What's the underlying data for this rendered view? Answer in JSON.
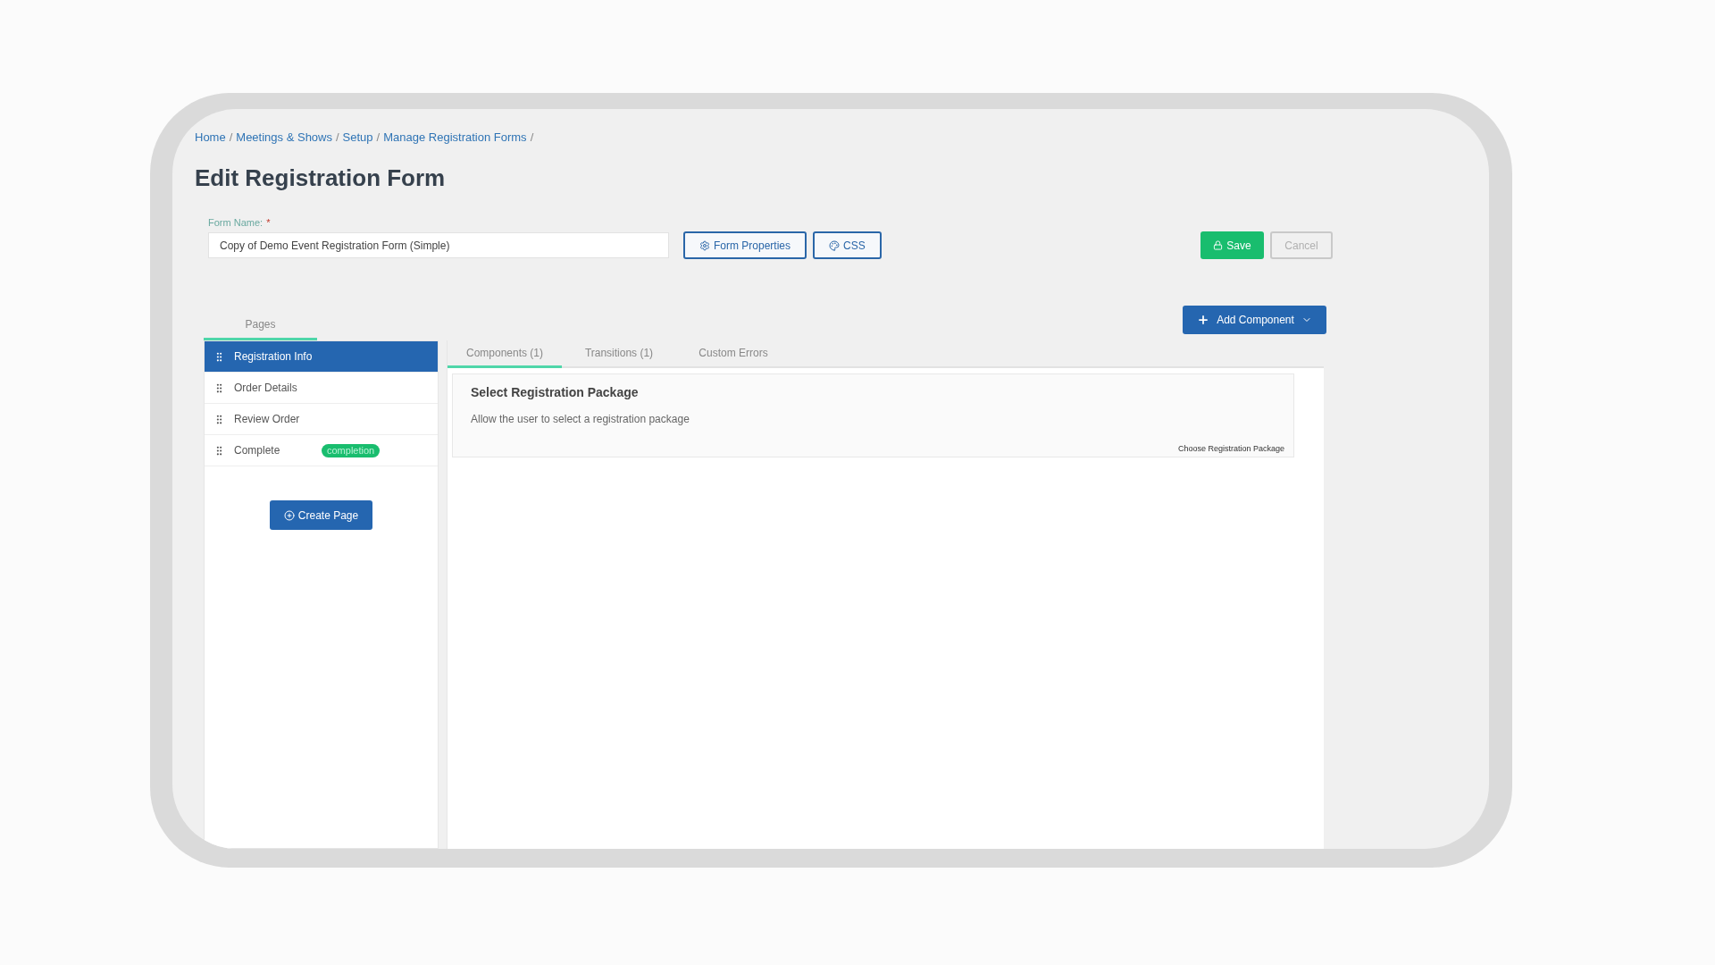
{
  "breadcrumb": [
    {
      "label": "Home",
      "separator": "/"
    },
    {
      "label": "Meetings & Shows",
      "separator": "/"
    },
    {
      "label": "Setup",
      "separator": "/"
    },
    {
      "label": "Manage Registration Forms",
      "separator": "/"
    }
  ],
  "title": "Edit Registration Form",
  "form_name": {
    "label": "Form Name:",
    "required_mark": "*",
    "value": "Copy of Demo Event Registration Form (Simple)"
  },
  "toolbar": [
    {
      "kind": "properties",
      "label": "Form Properties"
    },
    {
      "kind": "css",
      "label": "CSS"
    }
  ],
  "actions": [
    {
      "kind": "save",
      "label": "Save"
    },
    {
      "kind": "cancel",
      "label": "Cancel"
    }
  ],
  "pages_tab": {
    "label": "Pages",
    "selected": true
  },
  "add_component": {
    "label": "Add Component"
  },
  "pages": [
    {
      "label": "Registration Info",
      "selected": true
    },
    {
      "label": "Order Details",
      "selected": false
    },
    {
      "label": "Review Order",
      "selected": false
    },
    {
      "label": "Complete",
      "selected": false,
      "badge": "completion"
    }
  ],
  "create_page": {
    "label": "Create Page"
  },
  "tabs": [
    {
      "label": "Components (1)",
      "selected": true
    },
    {
      "label": "Transitions (1)",
      "selected": false
    },
    {
      "label": "Custom Errors",
      "selected": false
    }
  ],
  "components": [
    {
      "title": "Select Registration Package",
      "description": "Allow the user to select a registration package",
      "type_label": "Choose Registration Package"
    }
  ]
}
